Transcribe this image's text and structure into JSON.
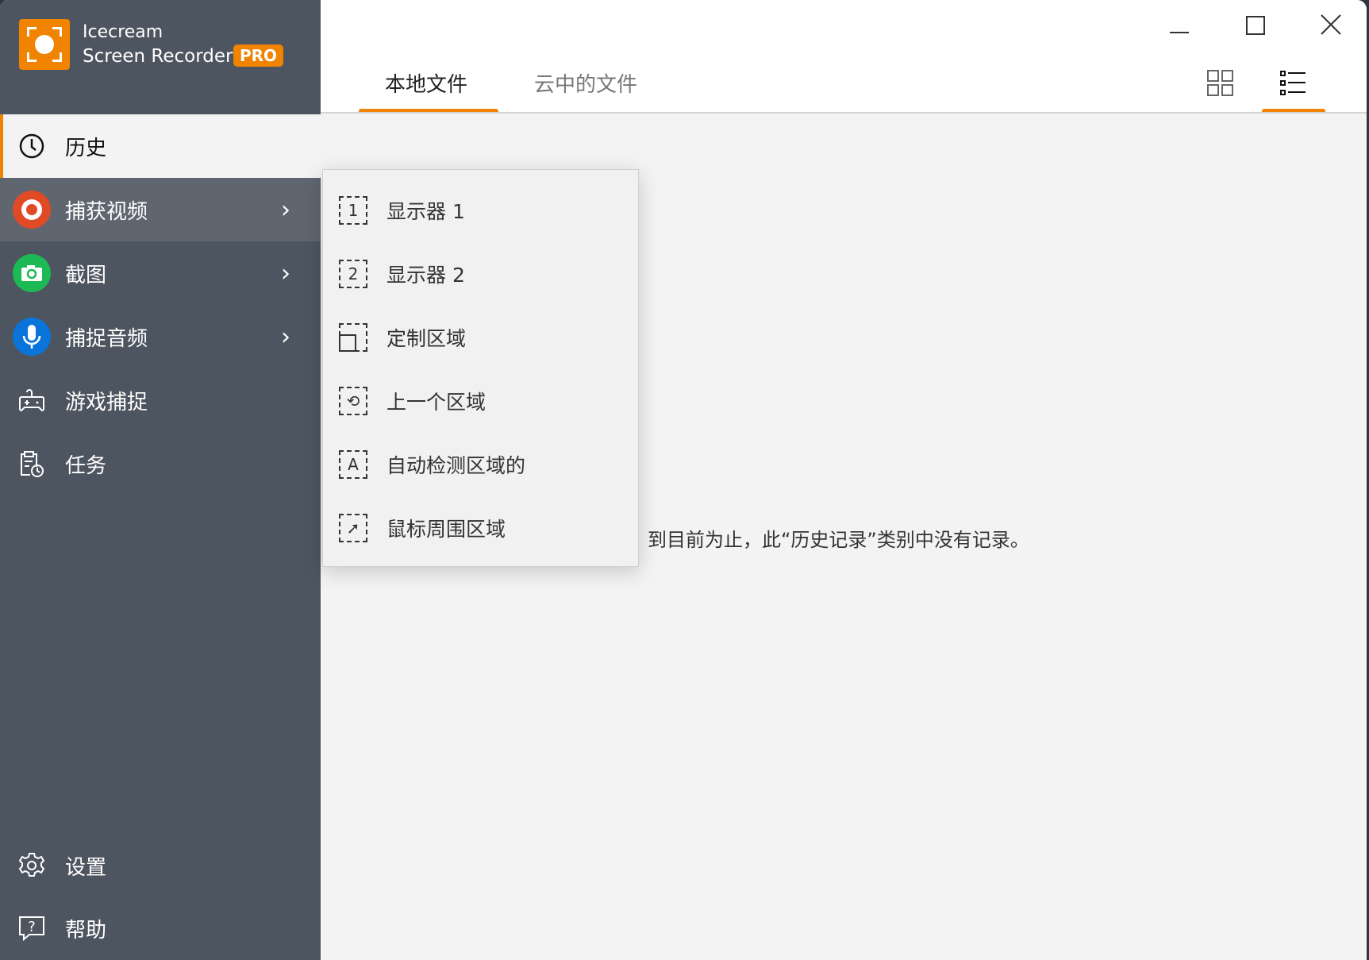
{
  "app": {
    "name_line1": "Icecream",
    "name_line2": "Screen Recorder",
    "badge": "PRO",
    "accent": "#f08300"
  },
  "sidebar": {
    "items": [
      {
        "label": "历史",
        "icon": "clock-icon"
      },
      {
        "label": "捕获视频",
        "icon": "record-icon",
        "color": "#e04a25"
      },
      {
        "label": "截图",
        "icon": "camera-icon",
        "color": "#1db954"
      },
      {
        "label": "捕捉音频",
        "icon": "microphone-icon",
        "color": "#0a74da"
      },
      {
        "label": "游戏捕捉",
        "icon": "gamepad-icon"
      },
      {
        "label": "任务",
        "icon": "tasks-icon"
      }
    ],
    "bottom": [
      {
        "label": "设置",
        "icon": "gear-icon"
      },
      {
        "label": "帮助",
        "icon": "help-icon"
      }
    ]
  },
  "tabs": [
    {
      "label": "本地文件"
    },
    {
      "label": "云中的文件"
    }
  ],
  "menu": {
    "items": [
      {
        "label": "显示器 1",
        "glyph": "1"
      },
      {
        "label": "显示器 2",
        "glyph": "2"
      },
      {
        "label": "定制区域",
        "glyph": ""
      },
      {
        "label": "上一个区域",
        "glyph": "⟲"
      },
      {
        "label": "自动检测区域的",
        "glyph": "A"
      },
      {
        "label": "鼠标周围区域",
        "glyph": "➚"
      }
    ]
  },
  "main": {
    "empty_message": "到目前为止，此“历史记录”类别中没有记录。"
  }
}
